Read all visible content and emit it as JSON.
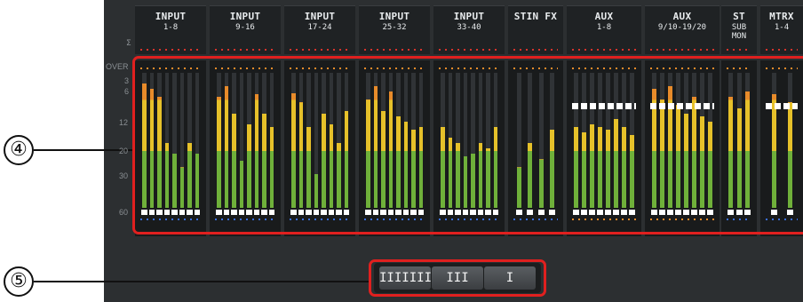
{
  "callouts": [
    {
      "label": "④"
    },
    {
      "label": "⑤"
    }
  ],
  "meter_headers": [
    {
      "title": "INPUT",
      "sub": "1-8"
    },
    {
      "title": "INPUT",
      "sub": "9-16"
    },
    {
      "title": "INPUT",
      "sub": "17-24"
    },
    {
      "title": "INPUT",
      "sub": "25-32"
    },
    {
      "title": "INPUT",
      "sub": "33-40"
    },
    {
      "title": "STIN FX",
      "sub": ""
    },
    {
      "title": "AUX",
      "sub": "1-8"
    },
    {
      "title": "AUX",
      "sub": "9/10-19/20"
    },
    {
      "title": "ST",
      "sub": "SUB\nMON"
    },
    {
      "title": "MTRX",
      "sub": "1-4"
    }
  ],
  "scale_labels": [
    "OVER",
    "3",
    "6",
    "12",
    "20",
    "30",
    "60"
  ],
  "sigma_label": "Σ",
  "meter_mode_buttons": [
    {
      "label": "IIIIIII",
      "active": true
    },
    {
      "label": "III",
      "active": false
    },
    {
      "label": "I",
      "active": false
    }
  ],
  "colors": {
    "callout_frame": "#e0201f",
    "meter_green": "#6fb03a",
    "meter_yellow": "#e6c12a",
    "meter_orange": "#e88b2a",
    "peak_marker": "#ffffff",
    "dot_red": "#d8332b",
    "dot_blue": "#3a6fe0"
  },
  "meter_levels": [
    [
      0.92,
      0.88,
      0.82,
      0.48,
      0.4,
      0.3,
      0.48,
      0.4
    ],
    [
      0.82,
      0.9,
      0.7,
      0.35,
      0.62,
      0.84,
      0.7,
      0.6
    ],
    [
      0.85,
      0.78,
      0.6,
      0.25,
      0.7,
      0.62,
      0.48,
      0.72
    ],
    [
      0.8,
      0.9,
      0.72,
      0.86,
      0.68,
      0.64,
      0.58,
      0.6
    ],
    [
      0.6,
      0.52,
      0.48,
      0.38,
      0.4,
      0.48,
      0.44,
      0.6
    ],
    [
      0.3,
      0.48,
      0.36,
      0.58
    ],
    [
      0.6,
      0.56,
      0.62,
      0.6,
      0.58,
      0.66,
      0.6,
      0.54
    ],
    [
      0.88,
      0.8,
      0.9,
      0.76,
      0.7,
      0.82,
      0.68,
      0.64
    ],
    [
      0.82,
      0.74,
      0.86
    ],
    [
      0.84,
      0.78
    ]
  ]
}
